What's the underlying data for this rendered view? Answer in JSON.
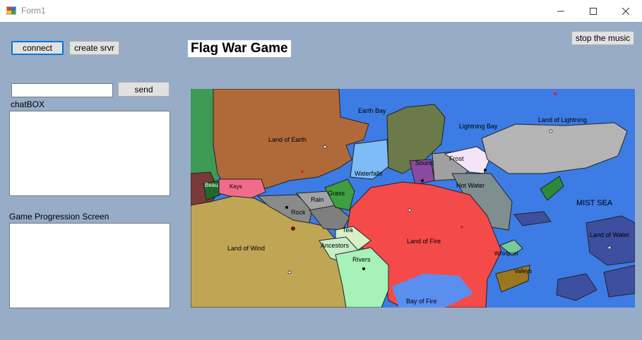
{
  "window": {
    "title": "Form1"
  },
  "toolbar": {
    "connect_label": "connect",
    "create_server_label": "create srvr",
    "stop_music_label": "stop the music"
  },
  "header": {
    "game_title": "Flag War Game"
  },
  "chat": {
    "input_value": "",
    "send_label": "send",
    "label": "chatBOX",
    "log": ""
  },
  "progress": {
    "label": "Game Progression Screen",
    "log": ""
  },
  "map": {
    "regions": [
      {
        "label": "Earth Bay"
      },
      {
        "label": "Land of Earth"
      },
      {
        "label": "Lightning Bay"
      },
      {
        "label": "Land of Lightning"
      },
      {
        "label": "Sound"
      },
      {
        "label": "Frost"
      },
      {
        "label": "Waterfalls"
      },
      {
        "label": "Hot Water"
      },
      {
        "label": "Keys"
      },
      {
        "label": "Grass"
      },
      {
        "label": "Rock"
      },
      {
        "label": "Rain"
      },
      {
        "label": "Land of Wind"
      },
      {
        "label": "Land of Fire"
      },
      {
        "label": "Tea"
      },
      {
        "label": "Ancestors"
      },
      {
        "label": "Rivers"
      },
      {
        "label": "Bay of Fire"
      },
      {
        "label": "Valleys"
      },
      {
        "label": "Whirlpool"
      },
      {
        "label": "MIST SEA"
      },
      {
        "label": "Land of Water"
      },
      {
        "label": "Beau"
      }
    ],
    "colors": {
      "sea": "#3c7ce4",
      "earth": "#b06a3a",
      "fire": "#f44a4a",
      "wind": "#bfa655",
      "lightning": "#b4b4b4",
      "water": "#3e4fa0"
    }
  }
}
